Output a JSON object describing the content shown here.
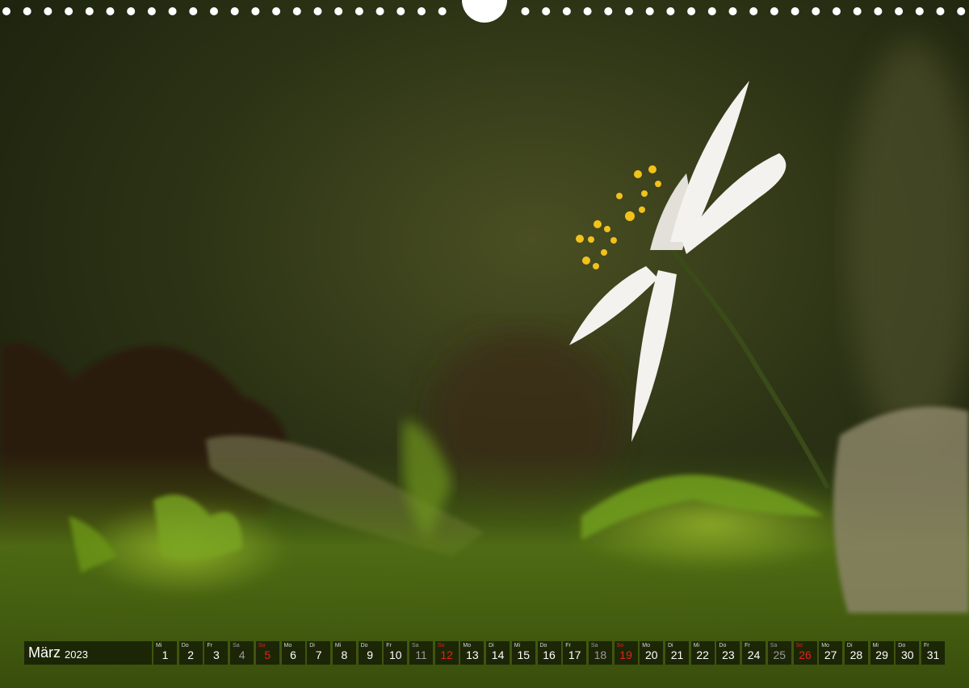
{
  "calendar": {
    "month": "März",
    "year": "2023",
    "days": [
      {
        "wd": "Mi",
        "n": "1",
        "type": "weekday"
      },
      {
        "wd": "Do",
        "n": "2",
        "type": "weekday"
      },
      {
        "wd": "Fr",
        "n": "3",
        "type": "weekday"
      },
      {
        "wd": "Sa",
        "n": "4",
        "type": "sat"
      },
      {
        "wd": "So",
        "n": "5",
        "type": "sun"
      },
      {
        "wd": "Mo",
        "n": "6",
        "type": "weekday"
      },
      {
        "wd": "Di",
        "n": "7",
        "type": "weekday"
      },
      {
        "wd": "Mi",
        "n": "8",
        "type": "weekday"
      },
      {
        "wd": "Do",
        "n": "9",
        "type": "weekday"
      },
      {
        "wd": "Fr",
        "n": "10",
        "type": "weekday"
      },
      {
        "wd": "Sa",
        "n": "11",
        "type": "sat"
      },
      {
        "wd": "So",
        "n": "12",
        "type": "sun"
      },
      {
        "wd": "Mo",
        "n": "13",
        "type": "weekday"
      },
      {
        "wd": "Di",
        "n": "14",
        "type": "weekday"
      },
      {
        "wd": "Mi",
        "n": "15",
        "type": "weekday"
      },
      {
        "wd": "Do",
        "n": "16",
        "type": "weekday"
      },
      {
        "wd": "Fr",
        "n": "17",
        "type": "weekday"
      },
      {
        "wd": "Sa",
        "n": "18",
        "type": "sat"
      },
      {
        "wd": "So",
        "n": "19",
        "type": "sun"
      },
      {
        "wd": "Mo",
        "n": "20",
        "type": "weekday"
      },
      {
        "wd": "Di",
        "n": "21",
        "type": "weekday"
      },
      {
        "wd": "Mi",
        "n": "22",
        "type": "weekday"
      },
      {
        "wd": "Do",
        "n": "23",
        "type": "weekday"
      },
      {
        "wd": "Fr",
        "n": "24",
        "type": "weekday"
      },
      {
        "wd": "Sa",
        "n": "25",
        "type": "sat"
      },
      {
        "wd": "So",
        "n": "26",
        "type": "sun"
      },
      {
        "wd": "Mo",
        "n": "27",
        "type": "weekday"
      },
      {
        "wd": "Di",
        "n": "28",
        "type": "weekday"
      },
      {
        "wd": "Mi",
        "n": "29",
        "type": "weekday"
      },
      {
        "wd": "Do",
        "n": "30",
        "type": "weekday"
      },
      {
        "wd": "Fr",
        "n": "31",
        "type": "weekday"
      }
    ]
  },
  "colors": {
    "sunday": "#e0231f",
    "saturday": "#9a9a9a",
    "petal": "#f4f2ee",
    "stamen": "#f2c21b"
  },
  "photo": {
    "subject": "wood-anemone-flower-icon"
  }
}
